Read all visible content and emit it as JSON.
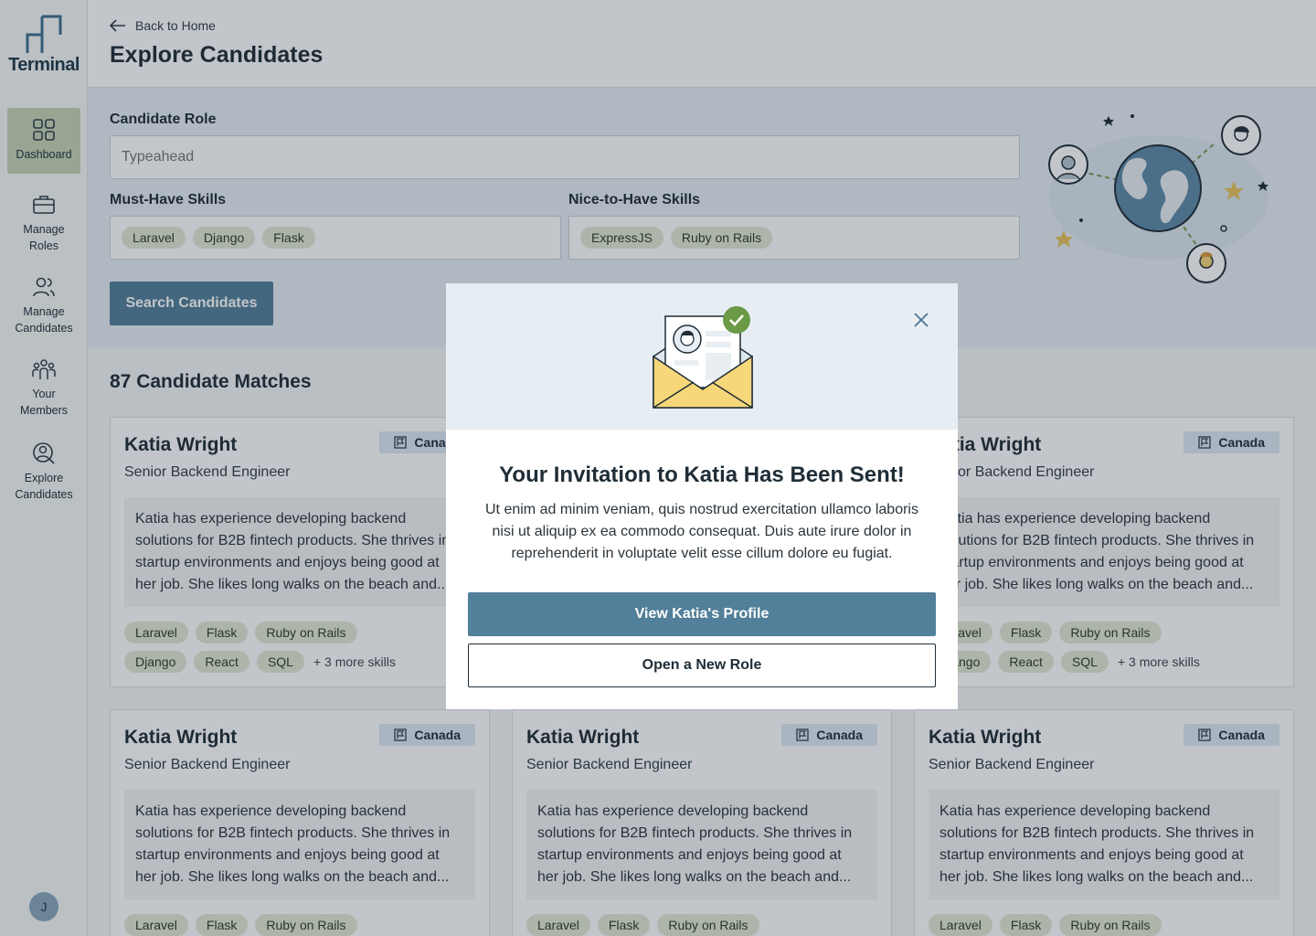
{
  "app": {
    "logo_text": "Terminal"
  },
  "sidebar": {
    "items": [
      {
        "label": "Dashboard",
        "icon": "grid-icon",
        "active": true
      },
      {
        "label": "Manage Roles",
        "icon": "briefcase-icon"
      },
      {
        "label": "Manage Candidates",
        "icon": "users-icon"
      },
      {
        "label": "Your Members",
        "icon": "team-icon"
      },
      {
        "label": "Explore Candidates",
        "icon": "search-user-icon"
      }
    ],
    "avatar_initial": "J"
  },
  "header": {
    "back_label": "Back to Home",
    "title": "Explore Candidates"
  },
  "search": {
    "role_label": "Candidate Role",
    "role_placeholder": "Typeahead",
    "must_have_label": "Must-Have Skills",
    "must_have_tags": [
      "Laravel",
      "Django",
      "Flask"
    ],
    "nice_to_have_label": "Nice-to-Have Skills",
    "nice_to_have_tags": [
      "ExpressJS",
      "Ruby on Rails"
    ],
    "button_label": "Search Candidates"
  },
  "results": {
    "title": "87 Candidate Matches",
    "cards": [
      {
        "name": "Katia Wright",
        "role": "Senior Backend Engineer",
        "location": "Canada",
        "bio": "Katia has experience developing backend solutions for B2B fintech products. She thrives in startup environments and enjoys being good at her job. She likes long walks on the beach and...",
        "skills_row1": [
          "Laravel",
          "Flask",
          "Ruby on Rails"
        ],
        "skills_row2": [
          "Django",
          "React",
          "SQL"
        ],
        "more_skills": "+ 3 more skills"
      }
    ]
  },
  "modal": {
    "title": "Your Invitation to Katia Has Been Sent!",
    "body": "Ut enim ad minim veniam, quis nostrud exercitation ullamco laboris nisi ut aliquip ex ea commodo consequat. Duis aute irure dolor in reprehenderit in voluptate velit esse cillum dolore eu fugiat.",
    "primary_button": "View Katia's Profile",
    "secondary_button": "Open a New Role"
  },
  "colors": {
    "brand": "#527f99",
    "tag_bg": "#e2ead6",
    "active_nav": "#c6d4b5",
    "check_green": "#6a9a46",
    "envelope_yellow": "#f6d77a"
  }
}
